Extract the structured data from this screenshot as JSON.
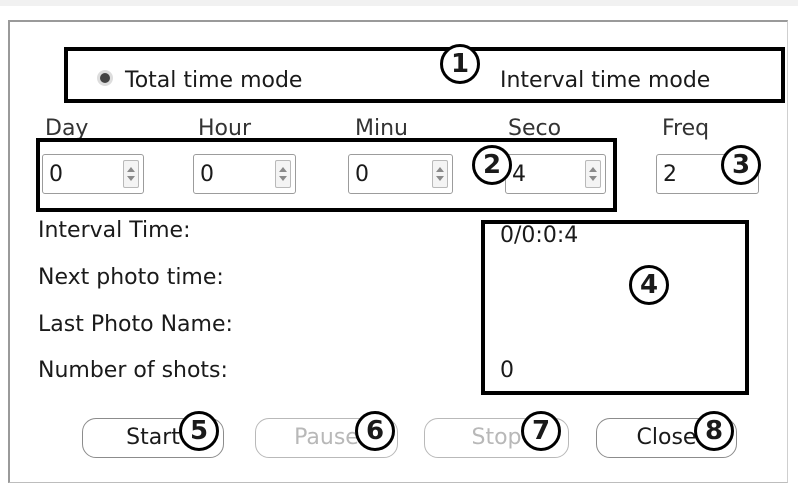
{
  "mode_options": {
    "total": "Total time mode",
    "interval": "Interval time mode",
    "selected": "total"
  },
  "timer_fields": [
    {
      "label": "Day",
      "value": "0"
    },
    {
      "label": "Hour",
      "value": "0"
    },
    {
      "label": "Minu",
      "value": "0"
    },
    {
      "label": "Seco",
      "value": "4"
    }
  ],
  "freq": {
    "label": "Freq",
    "value": "2"
  },
  "info": {
    "interval_time_label": "Interval Time:",
    "interval_time_value": "0/0:0:4",
    "next_photo_label": "Next photo time:",
    "next_photo_value": "",
    "last_photo_label": "Last Photo Name:",
    "last_photo_value": "",
    "shots_label": "Number of shots:",
    "shots_value": "0"
  },
  "buttons": {
    "start": "Start",
    "pause": "Pause",
    "stop": "Stop",
    "close": "Close"
  },
  "callouts": [
    "1",
    "2",
    "3",
    "4",
    "5",
    "6",
    "7",
    "8"
  ]
}
